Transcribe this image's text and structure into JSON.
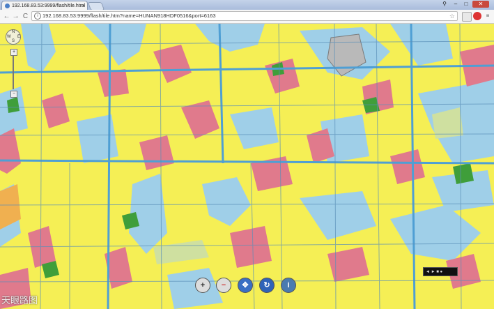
{
  "browser": {
    "tab_title": "192.168.83.53:9999/flash/tile.html",
    "tab_close": "×",
    "url": "192.168.83.53:9999/flash/tile.htm?name=HUNAN918HDF0516&port=6163",
    "nav": {
      "back": "←",
      "forward": "→",
      "reload": "C"
    },
    "window_controls": {
      "user": "⚲",
      "minimize": "–",
      "maximize": "□",
      "close": "✕"
    }
  },
  "map": {
    "pan": {
      "north": "N",
      "south": "S",
      "west": "W",
      "east": "E"
    },
    "zoom_in": "+",
    "zoom_out": "−",
    "watermark": "天眼路图",
    "mini_panel_text": "◄ ► ■ ●",
    "colors": {
      "residential": "#f5ef55",
      "commercial": "#e07a8c",
      "water": "#9fcfe8",
      "green": "#3f9e3a",
      "road": "#4f9fd4",
      "industrial": "#b9b9b9"
    }
  },
  "tools": {
    "zoom_in_tool": "+",
    "zoom_out_tool": "−",
    "pan_tool": "✥",
    "refresh_tool": "↻",
    "info_tool": "i"
  }
}
